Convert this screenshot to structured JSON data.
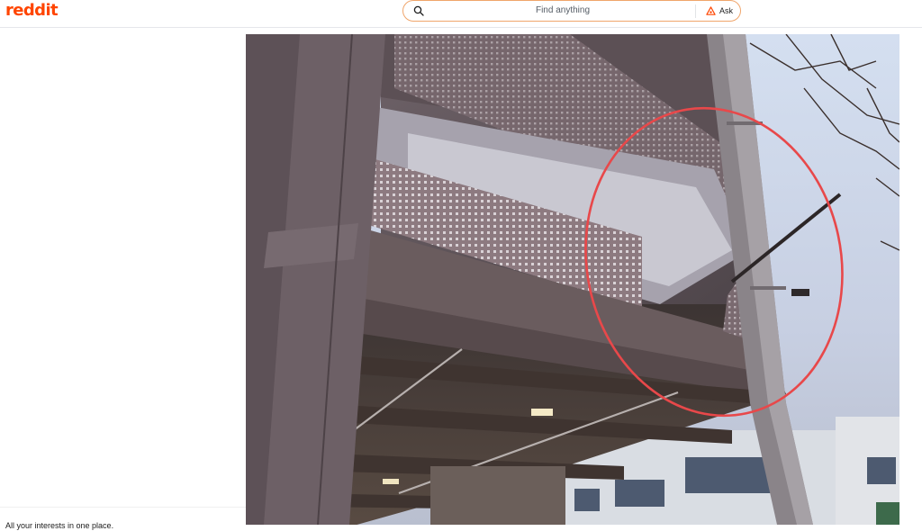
{
  "header": {
    "logo_text": "reddit",
    "search_placeholder": "Find anything",
    "ask_label": "Ask"
  },
  "post": {
    "image_icon": "parking-garage-photo"
  },
  "footer": {
    "tagline": "All your interests in one place."
  },
  "colors": {
    "brand": "#ff4500",
    "search_border": "#f0a56b",
    "annotation_circle": "#e8484a"
  }
}
